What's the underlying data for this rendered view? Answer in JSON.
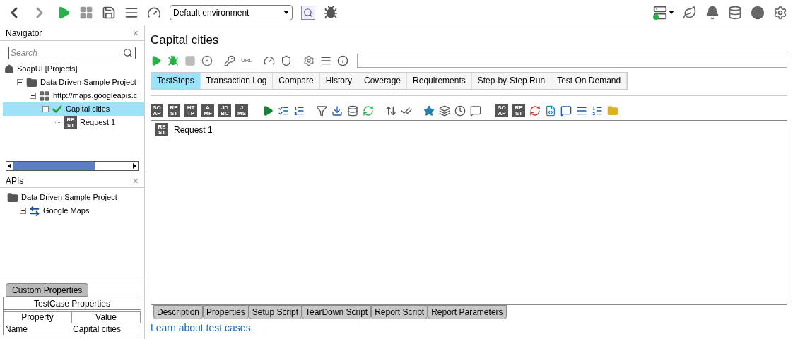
{
  "toolbar": {
    "environment": "Default environment"
  },
  "navigator": {
    "title": "Navigator",
    "close": "×",
    "search": {
      "placeholder": "Search"
    },
    "tree": [
      {
        "kind": "root",
        "label": "SoapUI [Projects]",
        "children": [
          {
            "kind": "folder",
            "label": "Data Driven Sample Project",
            "expanded": true,
            "selected": false,
            "children": [
              {
                "kind": "service",
                "label": "http://maps.googleapis.c",
                "expanded": true,
                "selected": false,
                "children": [
                  {
                    "kind": "testcase",
                    "label": "Capital cities",
                    "expanded": true,
                    "selected": true,
                    "children": [
                      {
                        "kind": "request",
                        "tile": "RE ST",
                        "label": "Request 1",
                        "selected": false
                      }
                    ]
                  }
                ]
              }
            ]
          }
        ]
      }
    ]
  },
  "apis": {
    "title": "APIs",
    "close": "×",
    "tree": [
      {
        "kind": "folder",
        "label": "Data Driven Sample Project",
        "children": [
          {
            "kind": "api",
            "label": "Google Maps",
            "expanded": false,
            "selected": false
          }
        ]
      }
    ]
  },
  "custom_properties": {
    "tab": "Custom Properties",
    "title": "TestCase Properties",
    "columns": [
      "Property",
      "Value"
    ],
    "rows": [
      [
        "Name",
        "Capital cities"
      ]
    ]
  },
  "main": {
    "title": "Capital cities",
    "url_label": "URL",
    "tabs": [
      {
        "label": "TestSteps",
        "selected": true
      },
      {
        "label": "Transaction Log",
        "selected": false
      },
      {
        "label": "Compare",
        "selected": false
      },
      {
        "label": "History",
        "selected": false
      },
      {
        "label": "Coverage",
        "selected": false
      },
      {
        "label": "Requirements",
        "selected": false
      },
      {
        "label": "Step-by-Step Run",
        "selected": false
      },
      {
        "label": "Test On Demand",
        "selected": false
      }
    ],
    "step_tiles": [
      "SO AP",
      "RE ST",
      "HT TP",
      "A MF",
      "JD BC",
      "J MS"
    ],
    "step_tiles_2": [
      "SO AP",
      "RE ST"
    ],
    "steps": [
      {
        "tile": "RE ST",
        "label": "Request 1"
      }
    ],
    "bottom_tabs": [
      {
        "label": "Description",
        "selected": false
      },
      {
        "label": "Properties",
        "selected": false
      },
      {
        "label": "Setup Script",
        "selected": false
      },
      {
        "label": "TearDown Script",
        "selected": false
      },
      {
        "label": "Report Script",
        "selected": false
      },
      {
        "label": "Report Parameters",
        "selected": false
      }
    ],
    "link": "Learn about test cases"
  }
}
